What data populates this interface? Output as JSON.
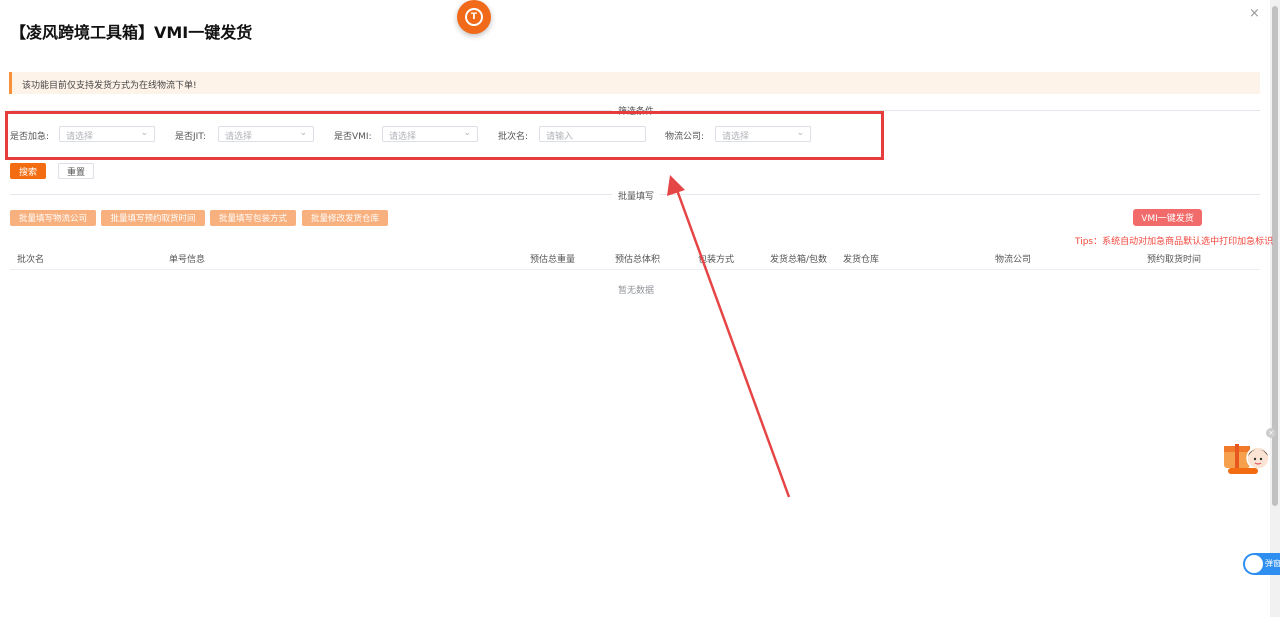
{
  "header": {
    "title": "【凌风跨境工具箱】VMI一键发货",
    "close": "×"
  },
  "notice": "该功能目前仅支持发货方式为在线物流下单!",
  "filter": {
    "section_title": "筛选条件",
    "urgent": {
      "label": "是否加急:",
      "placeholder": "请选择"
    },
    "jit": {
      "label": "是否JIT:",
      "placeholder": "请选择"
    },
    "vmi": {
      "label": "是否VMI:",
      "placeholder": "请选择"
    },
    "batch": {
      "label": "批次名:",
      "placeholder": "请输入"
    },
    "logistics": {
      "label": "物流公司:",
      "placeholder": "请选择"
    },
    "search": "搜索",
    "reset": "重置"
  },
  "bulk": {
    "section_title": "批量填写",
    "buttons": [
      "批量填写物流公司",
      "批量填写预约取货时间",
      "批量填写包装方式",
      "批量修改发货仓库"
    ],
    "vmi_ship": "VMI一键发货",
    "tips": "Tips：系统自动对加急商品默认选中打印加急标识"
  },
  "table": {
    "columns": [
      "批次名",
      "单号信息",
      "预估总重量",
      "预估总体积",
      "包装方式",
      "发货总箱/包数",
      "发货仓库",
      "物流公司",
      "预约取货时间"
    ],
    "empty": "暂无数据"
  },
  "widgets": {
    "toggle_label": "弹窗",
    "float_close": "×"
  },
  "colors": {
    "brand_orange": "#f36c12",
    "annotation_red": "#e63c3c",
    "vmi_button": "#f26b6b",
    "tips_red": "#f0473c"
  },
  "icons": [
    "app-logo-icon",
    "close-icon",
    "chevron-down-icon",
    "annotation-arrow-icon",
    "gift-avatar-icon"
  ]
}
